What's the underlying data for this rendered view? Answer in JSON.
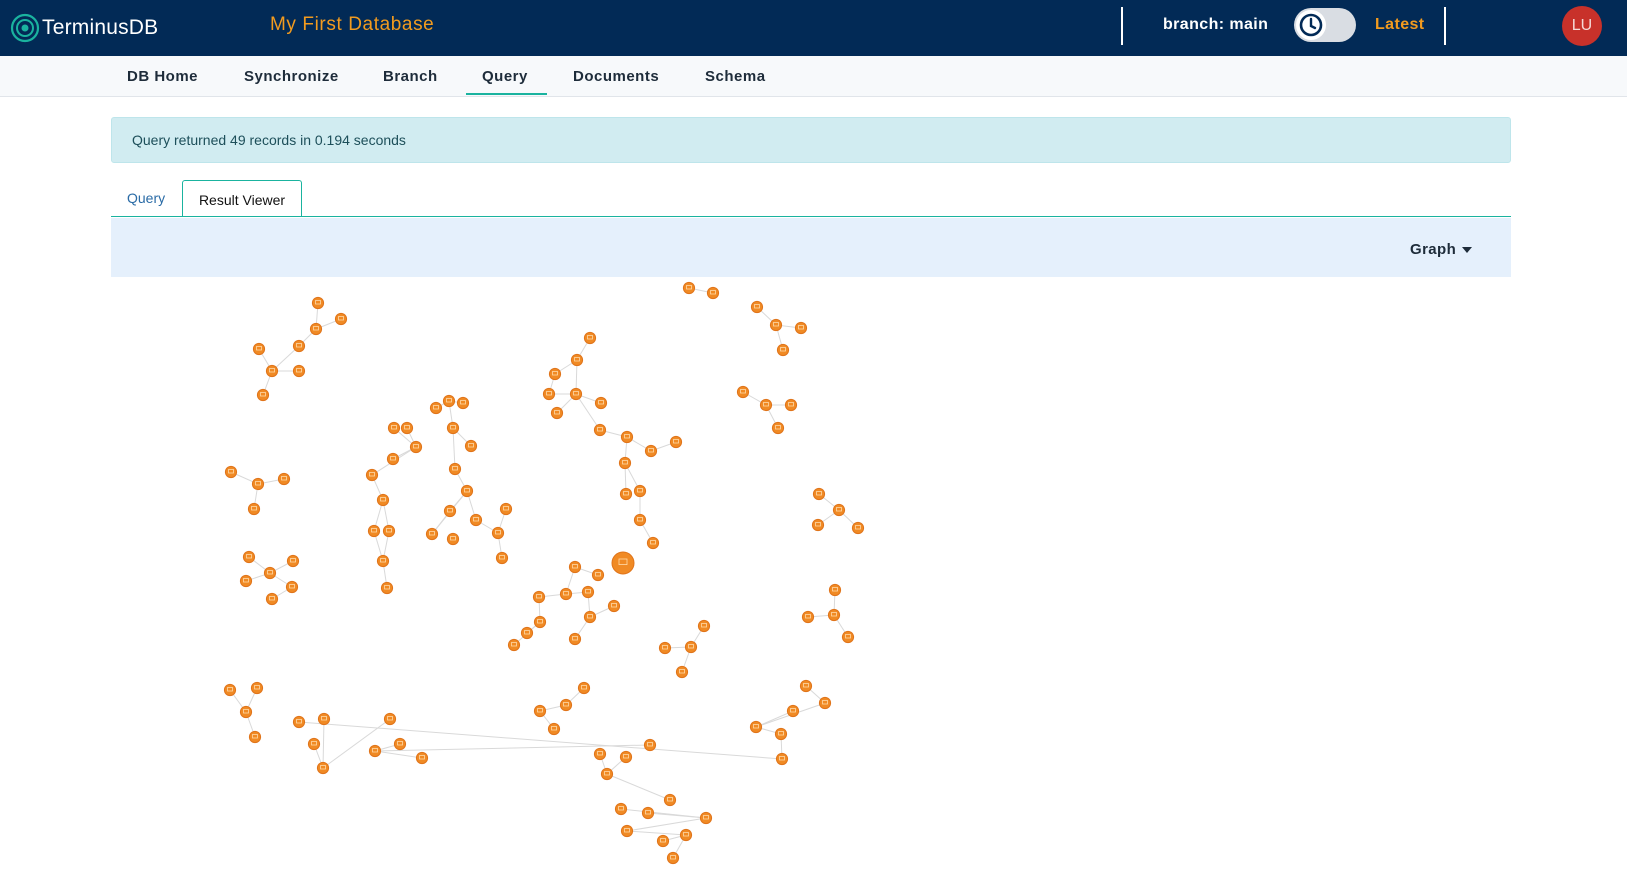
{
  "app": {
    "name": "TerminusDB",
    "database": "My First Database",
    "branch_label": "branch: main",
    "latest_label": "Latest",
    "user_initials": "LU"
  },
  "nav": {
    "items": [
      "DB Home",
      "Synchronize",
      "Branch",
      "Query",
      "Documents",
      "Schema"
    ],
    "active": "Query"
  },
  "alert": {
    "message": "Query returned 49 records in 0.194 seconds"
  },
  "tabs": {
    "query": "Query",
    "result_viewer": "Result Viewer",
    "active": "Result Viewer"
  },
  "viewer": {
    "mode": "Graph"
  },
  "icons": {
    "logo": "terminusdb-logo-icon",
    "time_travel": "clock-icon",
    "node": "node-circle-icon",
    "dropdown": "caret-down-icon"
  },
  "colors": {
    "header_bg": "#022a56",
    "accent_orange": "#f29b1f",
    "teal": "#1ab39f",
    "node_fill": "#f08a24",
    "avatar_bg": "#c8312a",
    "info_bg": "#d1ecf1",
    "viewer_bar_bg": "#e5f0fc"
  }
}
